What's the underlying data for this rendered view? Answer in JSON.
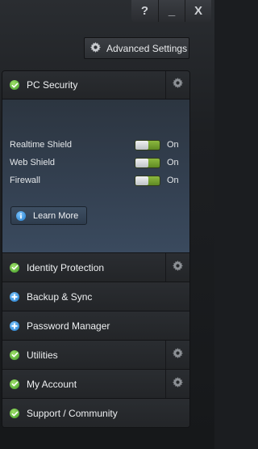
{
  "window": {
    "help_label": "?",
    "minimize_label": "_",
    "close_label": "X"
  },
  "advanced_settings": {
    "label": "Advanced Settings"
  },
  "pc_security": {
    "title": "PC Security",
    "toggles": [
      {
        "label": "Realtime Shield",
        "state": "On"
      },
      {
        "label": "Web Shield",
        "state": "On"
      },
      {
        "label": "Firewall",
        "state": "On"
      }
    ],
    "learn_more_label": "Learn More"
  },
  "sections": [
    {
      "label": "Identity Protection",
      "status": "check",
      "has_settings": true
    },
    {
      "label": "Backup & Sync",
      "status": "plus",
      "has_settings": false
    },
    {
      "label": "Password Manager",
      "status": "plus",
      "has_settings": false
    },
    {
      "label": "Utilities",
      "status": "check",
      "has_settings": true
    },
    {
      "label": "My Account",
      "status": "check",
      "has_settings": true
    },
    {
      "label": "Support / Community",
      "status": "check",
      "has_settings": false
    }
  ],
  "colors": {
    "check_green": "#4caf2f",
    "plus_blue": "#2a88d8",
    "toggle_green": "#7aa833"
  }
}
